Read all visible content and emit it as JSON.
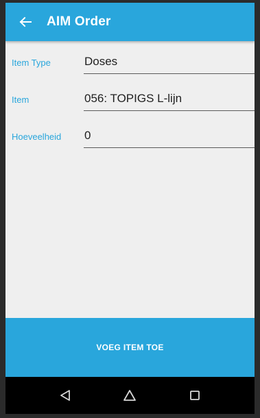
{
  "app_bar": {
    "title": "AIM Order",
    "back_icon": "arrow-left-icon"
  },
  "form": {
    "fields": [
      {
        "label": "Item Type",
        "value": "Doses"
      },
      {
        "label": "Item",
        "value": "056: TOPIGS L-lijn"
      },
      {
        "label": "Hoeveelheid",
        "value": "0"
      }
    ]
  },
  "actions": {
    "add_item_label": "VOEG ITEM TOE"
  },
  "system_nav": {
    "back_icon": "triangle-back-icon",
    "home_icon": "home-icon",
    "recents_icon": "square-recents-icon"
  },
  "colors": {
    "accent": "#29a6dc",
    "background": "#efefef",
    "nav_bar": "#000000"
  }
}
